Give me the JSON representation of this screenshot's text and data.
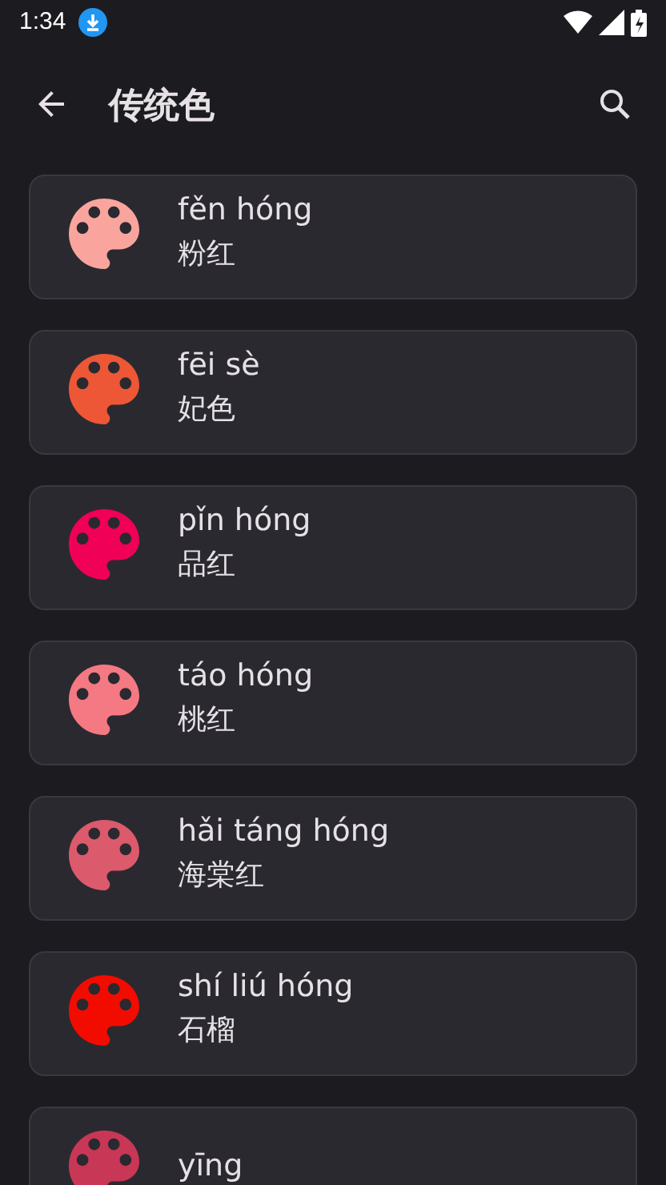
{
  "status_bar": {
    "time": "1:34"
  },
  "app_bar": {
    "title": "传统色"
  },
  "colors": [
    {
      "pinyin": "fěn hóng",
      "name": "粉红",
      "color": "#f9a59e"
    },
    {
      "pinyin": "fēi sè",
      "name": "妃色",
      "color": "#ed5736"
    },
    {
      "pinyin": "pǐn hóng",
      "name": "品红",
      "color": "#f00056"
    },
    {
      "pinyin": "táo hóng",
      "name": "桃红",
      "color": "#f47983"
    },
    {
      "pinyin": "hǎi táng hóng",
      "name": "海棠红",
      "color": "#db5a6b"
    },
    {
      "pinyin": "shí liú hóng",
      "name": "石榴",
      "color": "#f20c00"
    },
    {
      "pinyin": "yīng",
      "color": "#c93756"
    }
  ]
}
